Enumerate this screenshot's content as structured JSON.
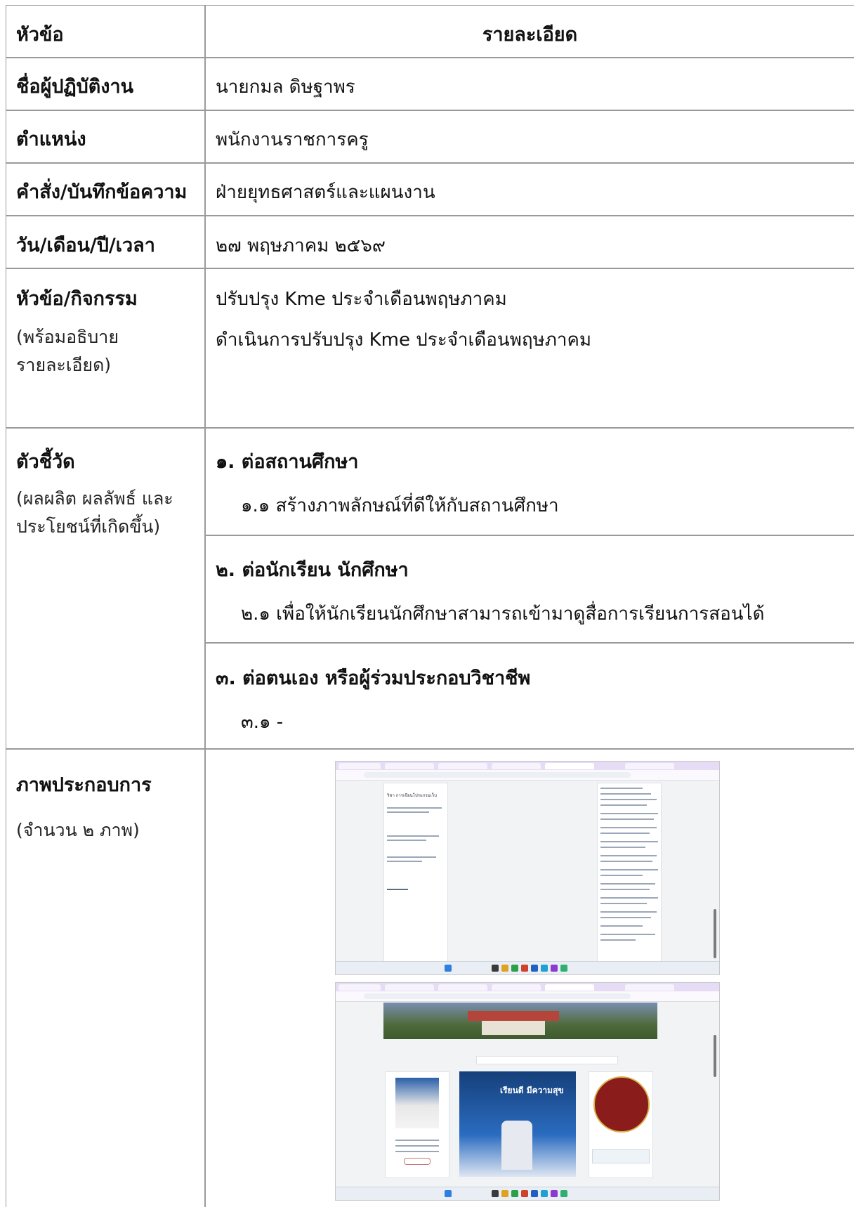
{
  "header": {
    "topic": "หัวข้อ",
    "detail": "รายละเอียด"
  },
  "rows": {
    "name": {
      "label": "ชื่อผู้ปฏิบัติงาน",
      "value": "นายกมล ดิษฐาพร"
    },
    "position": {
      "label": "ตำแหน่ง",
      "value": "พนักงานราชการครู"
    },
    "order": {
      "label": "คำสั่ง/บันทึกข้อความ",
      "value": "ฝ่ายยุทธศาสตร์และแผนงาน"
    },
    "date": {
      "label": "วัน/เดือน/ปี/เวลา",
      "value": "๒๗ พฤษภาคม ๒๕๖๙"
    },
    "activity": {
      "label": "หัวข้อ/กิจกรรม",
      "sub_label_1": "(พร้อมอธิบาย",
      "sub_label_2": "รายละเอียด)",
      "line1": "ปรับปรุง Kme ประจำเดือนพฤษภาคม",
      "line2": "ดำเนินการปรับปรุง Kme ประจำเดือนพฤษภาคม"
    },
    "indicator": {
      "label": "ตัวชี้วัด",
      "sub_label_1": "(ผลผลิต ผลลัพธ์ และ",
      "sub_label_2": "ประโยชน์ที่เกิดขึ้น)",
      "items": [
        {
          "title": "๑. ต่อสถานศึกษา",
          "detail": "๑.๑ สร้างภาพลักษณ์ที่ดีให้กับสถานศึกษา"
        },
        {
          "title": "๒. ต่อนักเรียน นักศึกษา",
          "detail": "๒.๑ เพื่อให้นักเรียนนักศึกษาสามารถเข้ามาดูสื่อการเรียนการสอนได้"
        },
        {
          "title": "๓. ต่อตนเอง หรือผู้ร่วมประกอบวิชาชีพ",
          "detail": "๓.๑ -"
        }
      ]
    },
    "images": {
      "label": "ภาพประกอบการ",
      "sub_label": "(จำนวน ๒ ภาพ)"
    }
  },
  "figures": {
    "shot1": {
      "sidebar_text": "วิชา การเขียนโปรแกรมเว็บ"
    },
    "shot2": {
      "banner_text": "เรียนดี มีความสุข"
    }
  },
  "colors": {
    "grid": "#9a9a9a",
    "tabbar": "#e6dcf5",
    "seal": "#8b1c1c"
  }
}
